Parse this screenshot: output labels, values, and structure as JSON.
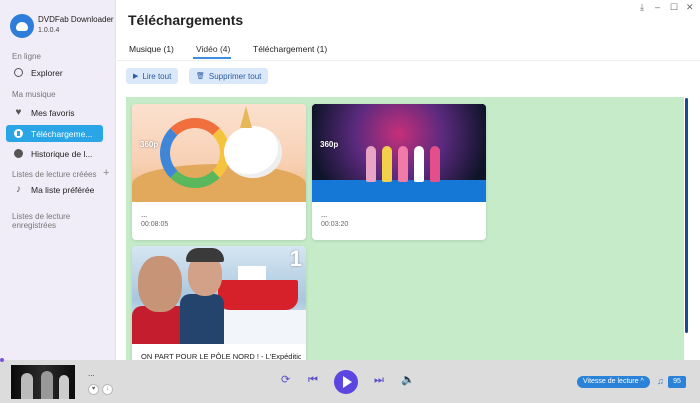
{
  "app": {
    "name": "DVDFab Downloader",
    "version": "1.0.0.4"
  },
  "sidebar": {
    "online_title": "En ligne",
    "explore": "Explorer",
    "music_title": "Ma musique",
    "favorites": "Mes favoris",
    "downloads": "Téléchargeme...",
    "history": "Historique de l...",
    "created_playlists_title": "Listes de lecture créées",
    "plus_icon": "+",
    "favorite_playlist": "Ma liste préférée",
    "saved_playlists_title": "Listes de lecture enregistrées"
  },
  "window": {
    "restore_icon": "⤓",
    "minimize_icon": "–",
    "maximize_icon": "☐",
    "close_icon": "✕"
  },
  "header": {
    "title": "Téléchargements",
    "tabs": [
      {
        "label": "Musique (1)"
      },
      {
        "label": "Vidéo (4)"
      },
      {
        "label": "Téléchargement (1)"
      }
    ],
    "play_all": "Lire tout",
    "delete_all": "Supprimer tout"
  },
  "videos": [
    {
      "quality": "360p",
      "title": "...",
      "duration": "00:08:05"
    },
    {
      "quality": "360p",
      "title": "...",
      "duration": "00:03:20"
    },
    {
      "quality": "",
      "title": "ON PART POUR LE PÔLE NORD ! - L'Expédition P...",
      "duration": ""
    }
  ],
  "player": {
    "now_title": "...",
    "speed_label": "Vitesse de lecture ^",
    "volume": "95"
  },
  "colors": {
    "accent": "#5b46e0",
    "active_nav": "#2aa5e6",
    "content_bg": "#c5ebc9",
    "button_bg": "#dbe8f9"
  }
}
